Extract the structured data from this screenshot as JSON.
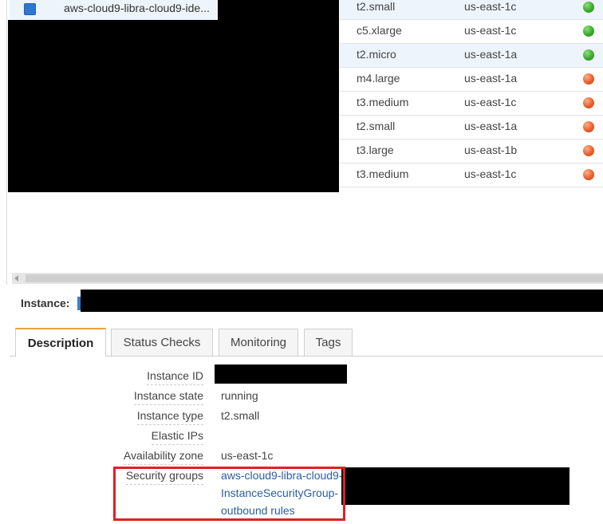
{
  "instances": {
    "selected_name": "aws-cloud9-libra-cloud9-ide...",
    "rows": [
      {
        "type": "t2.small",
        "az": "us-east-1c",
        "state": "running",
        "status_color": "#3aab2b"
      },
      {
        "type": "c5.xlarge",
        "az": "us-east-1c",
        "state": "running",
        "status_color": "#3aab2b"
      },
      {
        "type": "t2.micro",
        "az": "us-east-1a",
        "state": "running",
        "status_color": "#3aab2b"
      },
      {
        "type": "m4.large",
        "az": "us-east-1a",
        "state": "stopped",
        "status_color": "#ec5d2a"
      },
      {
        "type": "t3.medium",
        "az": "us-east-1c",
        "state": "stopped",
        "status_color": "#ec5d2a"
      },
      {
        "type": "t2.small",
        "az": "us-east-1a",
        "state": "stopped",
        "status_color": "#ec5d2a"
      },
      {
        "type": "t3.large",
        "az": "us-east-1b",
        "state": "stopped",
        "status_color": "#ec5d2a"
      },
      {
        "type": "t3.medium",
        "az": "us-east-1c",
        "state": "stopped",
        "status_color": "#ec5d2a"
      }
    ]
  },
  "detail": {
    "instance_label": "Instance:"
  },
  "tabs": [
    {
      "label": "Description",
      "active": true
    },
    {
      "label": "Status Checks",
      "active": false
    },
    {
      "label": "Monitoring",
      "active": false
    },
    {
      "label": "Tags",
      "active": false
    }
  ],
  "description": {
    "instance_id_label": "Instance ID",
    "instance_state_label": "Instance state",
    "instance_state_value": "running",
    "instance_type_label": "Instance type",
    "instance_type_value": "t2.small",
    "elastic_ips_label": "Elastic IPs",
    "elastic_ips_value": "",
    "availability_zone_label": "Availability zone",
    "availability_zone_value": "us-east-1c",
    "security_groups_label": "Security groups",
    "security_group_link_1": "aws-cloud9-libra-cloud9-",
    "security_group_link_2": "InstanceSecurityGroup-",
    "outbound_rules_link": "outbound rules"
  },
  "colors": {
    "accent_tab": "#e8a33d",
    "link": "#2a5f9e",
    "highlight": "#e0201f",
    "selected_row": "#eef4fb"
  }
}
